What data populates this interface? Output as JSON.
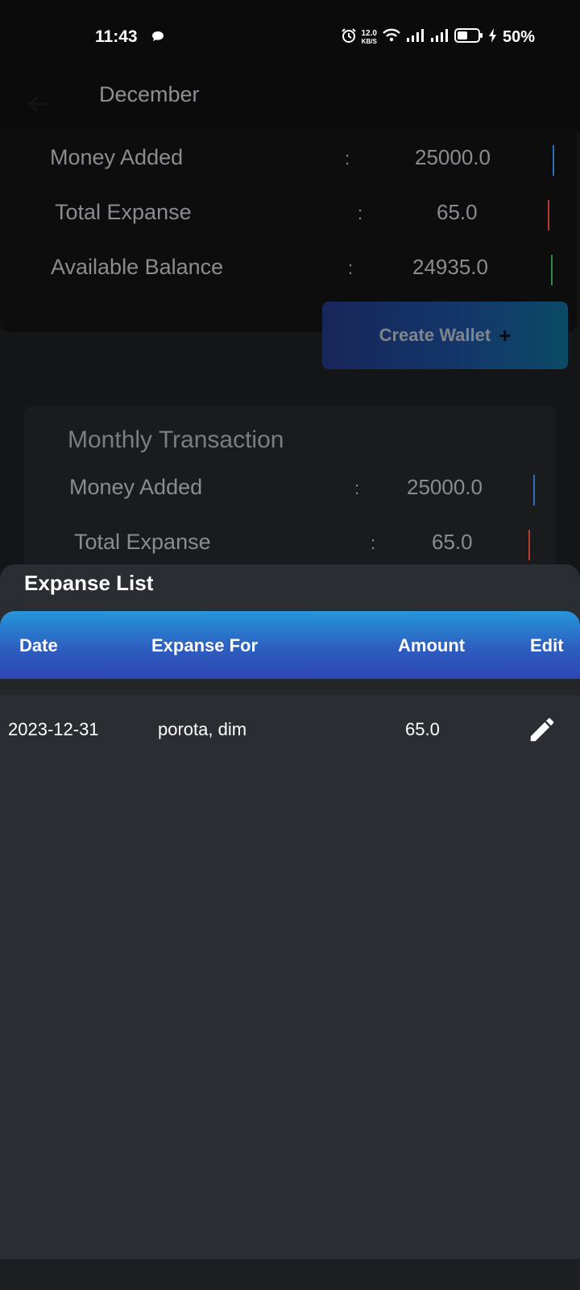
{
  "status_bar": {
    "time": "11:43",
    "net_speed_value": "12.0",
    "net_speed_unit": "KB/S",
    "battery": "50%",
    "icons": [
      "chat-bubble-icon",
      "alarm-icon",
      "wifi-icon",
      "signal-icon",
      "signal-icon",
      "battery-icon",
      "charging-icon"
    ]
  },
  "header": {
    "title": "December"
  },
  "summary": {
    "rows": [
      {
        "label": "Money Added",
        "colon": ":",
        "value": "25000.0",
        "bar_color": "#2a6fb8"
      },
      {
        "label": "Total Expanse",
        "colon": ":",
        "value": "65.0",
        "bar_color": "#b8392e"
      },
      {
        "label": "Available Balance",
        "colon": ":",
        "value": "24935.0",
        "bar_color": "#2f8a45"
      }
    ]
  },
  "create_wallet": {
    "label": "Create Wallet",
    "plus": "+"
  },
  "monthly": {
    "title": "Monthly Transaction",
    "rows": [
      {
        "label": "Money Added",
        "colon": ":",
        "value": "25000.0",
        "bar_color": "#2a6fb8"
      },
      {
        "label": "Total Expanse",
        "colon": ":",
        "value": "65.0",
        "bar_color": "#b8392e"
      }
    ]
  },
  "expanse_list": {
    "title": "Expanse List",
    "headers": {
      "date": "Date",
      "for": "Expanse For",
      "amount": "Amount",
      "edit": "Edit"
    },
    "rows": [
      {
        "date": "2023-12-31",
        "for": "porota, dim",
        "amount": "65.0"
      }
    ]
  }
}
